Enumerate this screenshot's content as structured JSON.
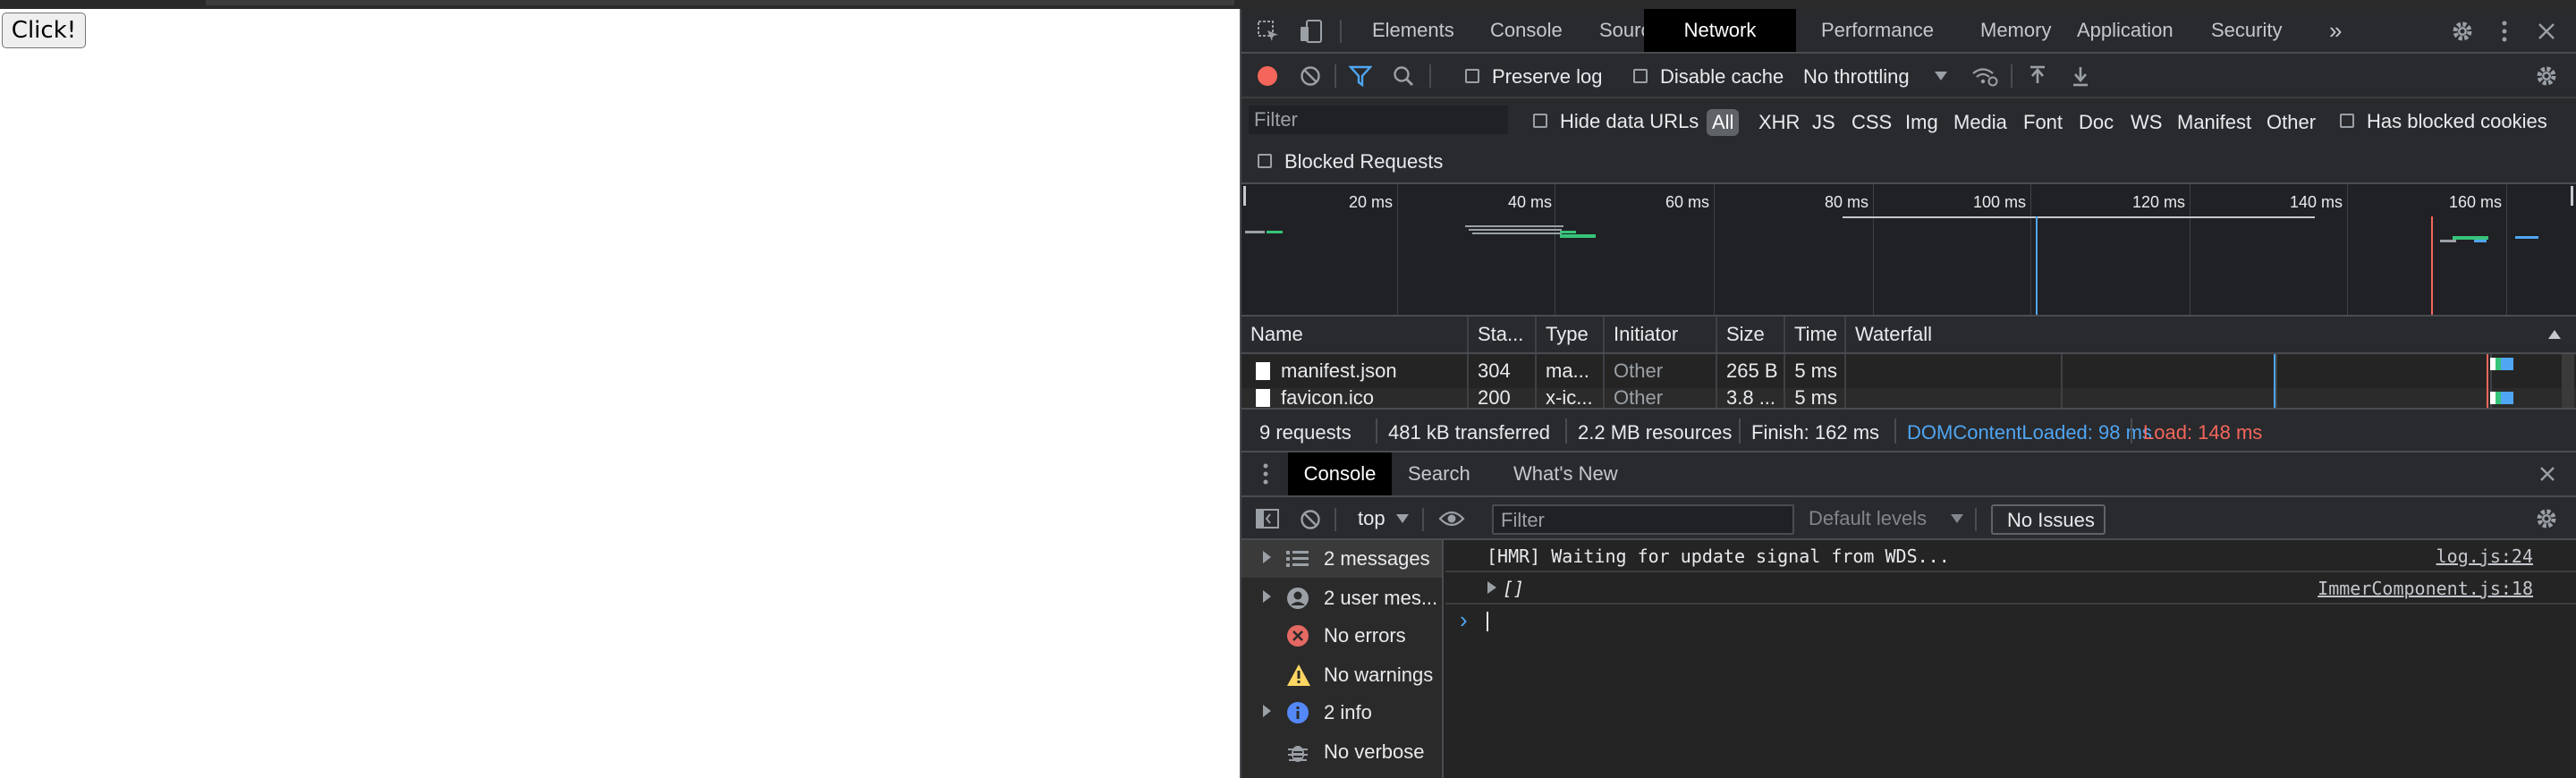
{
  "page": {
    "button_label": "Click!"
  },
  "devtools": {
    "tabs": [
      "Elements",
      "Console",
      "Sources",
      "Network",
      "Performance",
      "Memory",
      "Application",
      "Security"
    ],
    "active_tab": "Network",
    "more_tabs_glyph": "»",
    "network_toolbar": {
      "preserve_log": "Preserve log",
      "disable_cache": "Disable cache",
      "throttling": "No throttling"
    },
    "filter": {
      "placeholder": "Filter",
      "hide_data_urls": "Hide data URLs",
      "types": [
        "All",
        "XHR",
        "JS",
        "CSS",
        "Img",
        "Media",
        "Font",
        "Doc",
        "WS",
        "Manifest",
        "Other"
      ],
      "active_type": "All",
      "has_blocked_cookies": "Has blocked cookies",
      "blocked_requests": "Blocked Requests"
    },
    "overview": {
      "ticks": [
        "20 ms",
        "40 ms",
        "60 ms",
        "80 ms",
        "100 ms",
        "120 ms",
        "140 ms",
        "160 ms"
      ]
    },
    "table": {
      "columns": [
        "Name",
        "Sta...",
        "Type",
        "Initiator",
        "Size",
        "Time",
        "Waterfall"
      ],
      "rows": [
        {
          "name": "manifest.json",
          "status": "304",
          "type": "ma...",
          "initiator": "Other",
          "size": "265 B",
          "time": "5 ms"
        },
        {
          "name": "favicon.ico",
          "status": "200",
          "type": "x-ic...",
          "initiator": "Other",
          "size": "3.8 ...",
          "time": "5 ms"
        }
      ]
    },
    "summary": {
      "requests": "9 requests",
      "transferred": "481 kB transferred",
      "resources": "2.2 MB resources",
      "finish": "Finish: 162 ms",
      "dcl": "DOMContentLoaded: 98 ms",
      "load": "Load: 148 ms",
      "colors": {
        "dcl": "#4fa6f3",
        "load": "#f4665b"
      }
    },
    "drawer": {
      "tabs": [
        "Console",
        "Search",
        "What's New"
      ],
      "active_tab": "Console"
    },
    "console_toolbar": {
      "context": "top",
      "filter_placeholder": "Filter",
      "levels": "Default levels",
      "issues": "No Issues"
    },
    "console_sidebar": [
      {
        "label": "2 messages",
        "icon": "list-icon",
        "expandable": true
      },
      {
        "label": "2 user mes...",
        "icon": "user-icon",
        "expandable": true
      },
      {
        "label": "No errors",
        "icon": "error-icon",
        "expandable": false
      },
      {
        "label": "No warnings",
        "icon": "warning-icon",
        "expandable": false
      },
      {
        "label": "2 info",
        "icon": "info-icon",
        "expandable": true
      },
      {
        "label": "No verbose",
        "icon": "bug-icon",
        "expandable": false
      }
    ],
    "console_messages": [
      {
        "text": "[HMR] Waiting for update signal from WDS...",
        "source": "log.js:24"
      },
      {
        "text": "[]",
        "source": "ImmerComponent.js:18"
      }
    ],
    "prompt_glyph": "›"
  }
}
